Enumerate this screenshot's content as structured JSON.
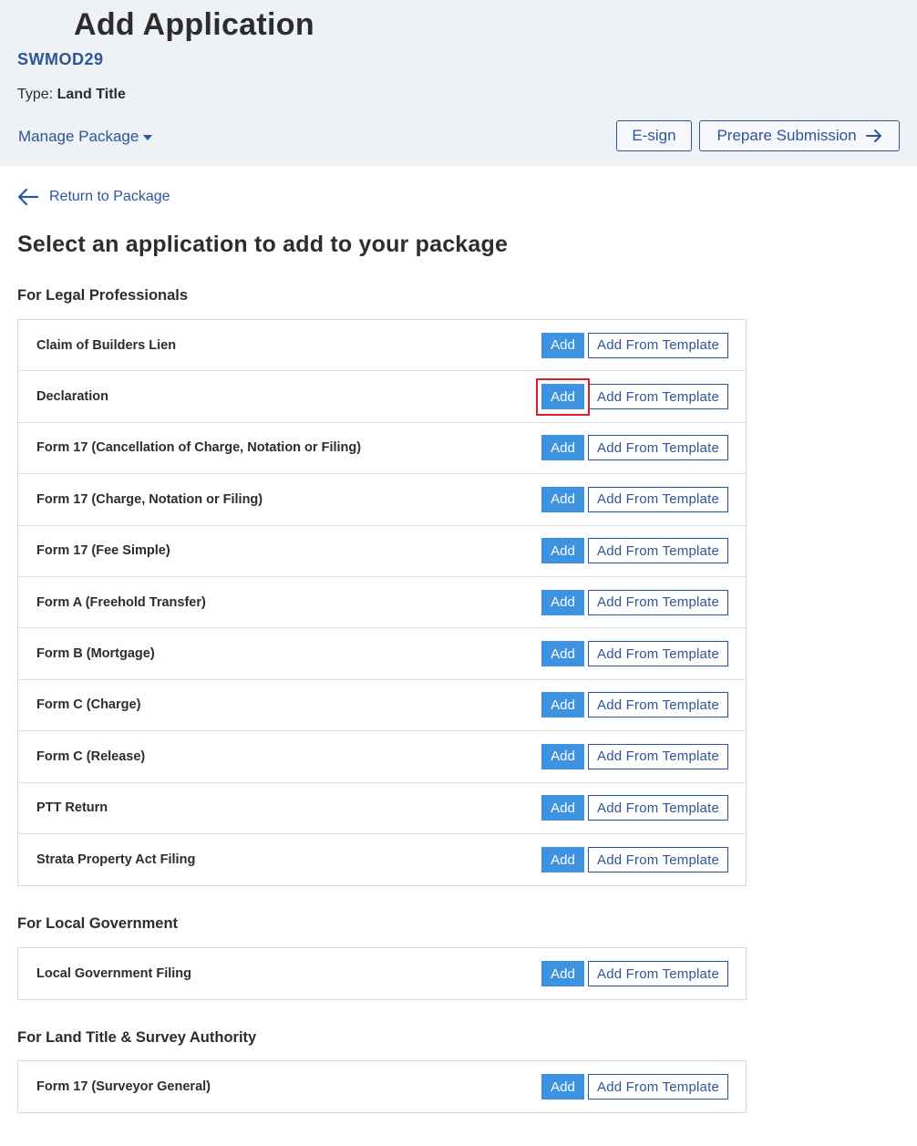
{
  "header": {
    "title": "Add Application",
    "package_id": "SWMOD29",
    "type_label": "Type:",
    "type_value": "Land Title",
    "manage_label": "Manage Package",
    "esign_label": "E-sign",
    "prepare_label": "Prepare Submission"
  },
  "nav": {
    "return_label": "Return to Package"
  },
  "main": {
    "heading": "Select an application to add to your package",
    "add_label": "Add",
    "template_label": "Add From Template",
    "groups": [
      {
        "title": "For Legal Professionals",
        "items": [
          "Claim of Builders Lien",
          "Declaration",
          "Form 17 (Cancellation of Charge, Notation or Filing)",
          "Form 17 (Charge, Notation or Filing)",
          "Form 17 (Fee Simple)",
          "Form A (Freehold Transfer)",
          "Form B (Mortgage)",
          "Form C (Charge)",
          "Form C (Release)",
          "PTT Return",
          "Strata Property Act Filing"
        ]
      },
      {
        "title": "For Local Government",
        "items": [
          "Local Government Filing"
        ]
      },
      {
        "title": "For Land Title & Survey Authority",
        "items": [
          "Form 17 (Surveyor General)"
        ]
      }
    ]
  },
  "colors": {
    "accent": "#2f5596",
    "add_button": "#3d93e0",
    "highlight": "#d8202a",
    "header_bg": "#eef1f5"
  },
  "icons": {
    "manage_caret": "caret-down-icon",
    "prepare_arrow": "arrow-right-icon",
    "return_arrow": "arrow-left-icon"
  }
}
